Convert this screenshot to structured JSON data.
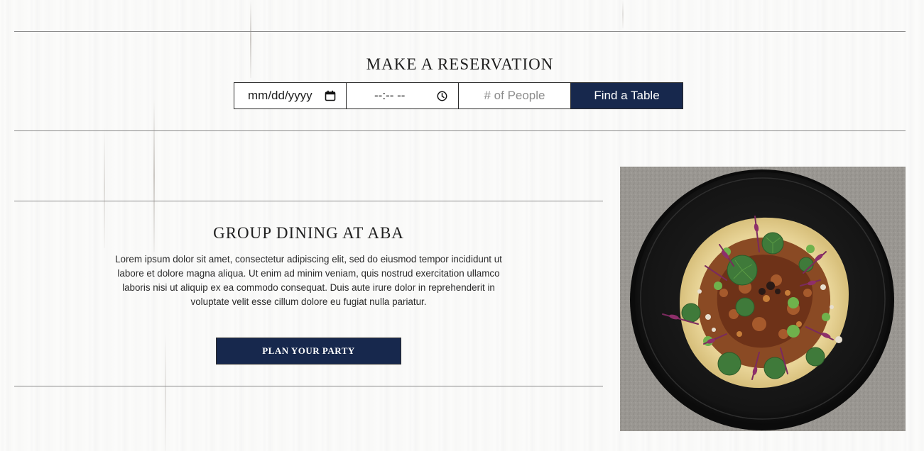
{
  "reservation": {
    "title": "MAKE A RESERVATION",
    "date_value": "mm/dd/yyyy",
    "date_icon": "calendar-icon",
    "time_value": "--:-- --",
    "time_icon": "clock-icon",
    "people_placeholder": "# of People",
    "find_button_label": "Find a Table"
  },
  "group_dining": {
    "title": "GROUP DINING AT ABA",
    "description": "Lorem ipsum dolor sit amet, consectetur adipiscing elit, sed do eiusmod tempor incididunt ut labore et dolore magna aliqua. Ut enim ad minim veniam, quis nostrud exercitation ullamco laboris nisi ut aliquip ex ea commodo consequat. Duis aute irure dolor in reprehenderit in voluptate velit esse cillum dolore eu fugiat nulla pariatur.",
    "button_label": "PLAN YOUR PARTY"
  },
  "colors": {
    "navy": "#17284d",
    "background": "#fbfbfa",
    "rule": "#8a8a8a"
  }
}
